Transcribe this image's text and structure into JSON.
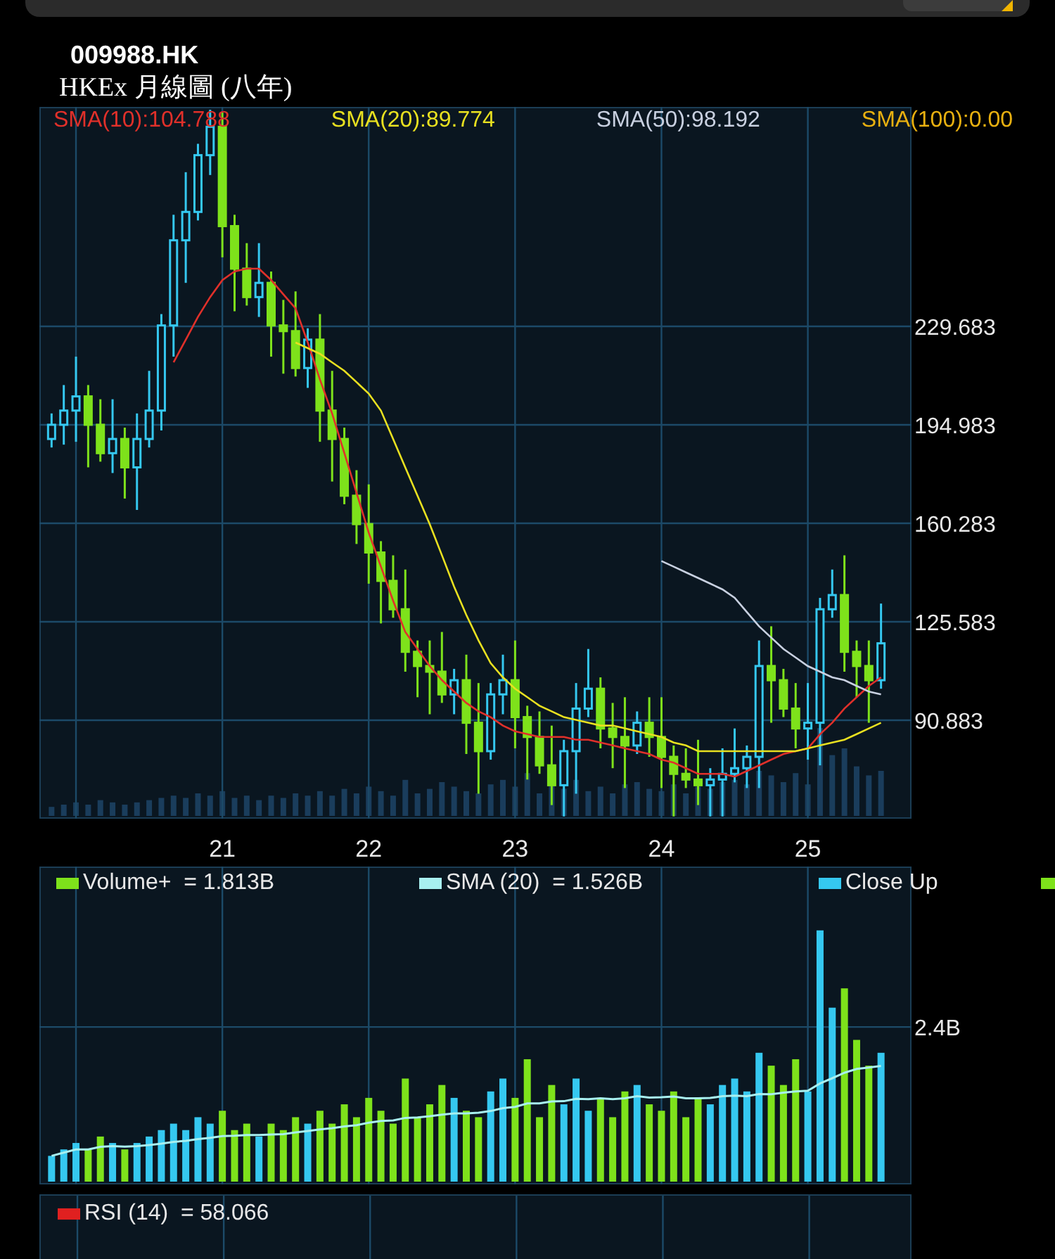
{
  "header": {
    "symbol": "009988.HK",
    "subtitle": "HKEx 月線圖 (八年)"
  },
  "price_chart": {
    "legend_extra": [
      {
        "label": "SMA(100):0.00",
        "color": "#e8b010"
      }
    ],
    "chart_data": {
      "type": "candlestick",
      "grid": true,
      "categories": [
        null,
        null,
        null,
        null,
        null,
        null,
        null,
        null,
        null,
        null,
        null,
        null,
        null,
        null,
        "21",
        null,
        null,
        null,
        null,
        null,
        null,
        null,
        null,
        null,
        null,
        null,
        "22",
        null,
        null,
        null,
        null,
        null,
        null,
        null,
        null,
        null,
        null,
        null,
        "23",
        null,
        null,
        null,
        null,
        null,
        null,
        null,
        null,
        null,
        null,
        null,
        "24",
        null,
        null,
        null,
        null,
        null,
        null,
        null,
        null,
        null,
        null,
        null,
        "25",
        null,
        null,
        null,
        null,
        null,
        null
      ],
      "yticks": [
        {
          "value": 90.883,
          "label": "90.883"
        },
        {
          "value": 125.583,
          "label": "125.583"
        },
        {
          "value": 160.283,
          "label": "160.283"
        },
        {
          "value": 194.983,
          "label": "194.983"
        },
        {
          "value": 229.683,
          "label": "229.683"
        }
      ],
      "ylim": [
        56.2,
        307
      ],
      "ohlc": [
        [
          190,
          199,
          187,
          195
        ],
        [
          195,
          209,
          188,
          200
        ],
        [
          200,
          219,
          189,
          205
        ],
        [
          205,
          209,
          180,
          195
        ],
        [
          195,
          204,
          182,
          185
        ],
        [
          185,
          204,
          178,
          190
        ],
        [
          190,
          194,
          169,
          180
        ],
        [
          180,
          199,
          165,
          190
        ],
        [
          190,
          214,
          187,
          200
        ],
        [
          200,
          234,
          193,
          230
        ],
        [
          230,
          269,
          219,
          260
        ],
        [
          260,
          284,
          245,
          270
        ],
        [
          270,
          294,
          267,
          290
        ],
        [
          290,
          306,
          283,
          300
        ],
        [
          300,
          305,
          254,
          265
        ],
        [
          265,
          269,
          235,
          250
        ],
        [
          250,
          259,
          237,
          240
        ],
        [
          240,
          259,
          233,
          245
        ],
        [
          245,
          249,
          219,
          230
        ],
        [
          230,
          239,
          213,
          228
        ],
        [
          228,
          242,
          212,
          215
        ],
        [
          215,
          229,
          208,
          225
        ],
        [
          225,
          234,
          189,
          200
        ],
        [
          200,
          214,
          175,
          190
        ],
        [
          190,
          194,
          167,
          170
        ],
        [
          170,
          179,
          153,
          160
        ],
        [
          160,
          174,
          139,
          150
        ],
        [
          150,
          154,
          125,
          140
        ],
        [
          140,
          149,
          127,
          130
        ],
        [
          130,
          144,
          108,
          115
        ],
        [
          115,
          119,
          99,
          110
        ],
        [
          110,
          119,
          93,
          108
        ],
        [
          108,
          122,
          97,
          100
        ],
        [
          100,
          109,
          93,
          105
        ],
        [
          105,
          114,
          79,
          90
        ],
        [
          90,
          104,
          65,
          80
        ],
        [
          80,
          104,
          77,
          100
        ],
        [
          100,
          114,
          93,
          105
        ],
        [
          105,
          119,
          81,
          92
        ],
        [
          92,
          96,
          70,
          85
        ],
        [
          85,
          94,
          72,
          75
        ],
        [
          75,
          89,
          61,
          68
        ],
        [
          68,
          84,
          57,
          80
        ],
        [
          80,
          104,
          65,
          95
        ],
        [
          95,
          116,
          92,
          102
        ],
        [
          102,
          106,
          81,
          88
        ],
        [
          88,
          97,
          74,
          85
        ],
        [
          85,
          99,
          67,
          82
        ],
        [
          82,
          94,
          79,
          90
        ],
        [
          90,
          99,
          78,
          85
        ],
        [
          85,
          99,
          67,
          78
        ],
        [
          78,
          82,
          57,
          72
        ],
        [
          72,
          81,
          67,
          70
        ],
        [
          70,
          84,
          61,
          68
        ],
        [
          68,
          74,
          57,
          70
        ],
        [
          70,
          81,
          57,
          72
        ],
        [
          72,
          88,
          69,
          74
        ],
        [
          74,
          82,
          67,
          78
        ],
        [
          78,
          119,
          67,
          110
        ],
        [
          110,
          124,
          90,
          105
        ],
        [
          105,
          109,
          92,
          95
        ],
        [
          95,
          104,
          81,
          88
        ],
        [
          88,
          104,
          77,
          90
        ],
        [
          90,
          134,
          75,
          130
        ],
        [
          130,
          144,
          127,
          135
        ],
        [
          135,
          149,
          108,
          115
        ],
        [
          115,
          119,
          99,
          110
        ],
        [
          110,
          119,
          90,
          105
        ],
        [
          105,
          132,
          102,
          118
        ]
      ],
      "series": [
        {
          "name": "SMA(10):104.788",
          "type": "line",
          "color": "#e0302a",
          "values": [
            null,
            null,
            null,
            null,
            null,
            null,
            null,
            null,
            null,
            null,
            217,
            225,
            233,
            240,
            246,
            249,
            250,
            250,
            246,
            241,
            236,
            224,
            211,
            199,
            185,
            171,
            157,
            145,
            133,
            122,
            116,
            110,
            105,
            101,
            97,
            94,
            92,
            89,
            87,
            86,
            85,
            85,
            85,
            84,
            84,
            83,
            82,
            81,
            80,
            79,
            77,
            76,
            74,
            72,
            72,
            72,
            71,
            73,
            75,
            77,
            79,
            80,
            81,
            86,
            90,
            95,
            99,
            103,
            106
          ]
        },
        {
          "name": "SMA(20):89.774",
          "type": "line",
          "color": "#e8e020",
          "values": [
            null,
            null,
            null,
            null,
            null,
            null,
            null,
            null,
            null,
            null,
            null,
            null,
            null,
            null,
            null,
            null,
            null,
            null,
            null,
            null,
            224,
            222,
            220,
            217,
            214,
            210,
            206,
            200,
            190,
            180,
            170,
            160,
            149,
            138,
            128,
            119,
            111,
            106,
            102,
            99,
            96,
            94,
            92,
            91,
            90,
            89,
            89,
            88,
            87,
            86,
            85,
            83,
            82,
            80,
            80,
            80,
            80,
            80,
            80,
            80,
            80,
            80,
            81,
            82,
            83,
            84,
            86,
            88,
            90
          ]
        },
        {
          "name": "SMA(50):98.192",
          "type": "line",
          "color": "#c8d0e0",
          "values": [
            null,
            null,
            null,
            null,
            null,
            null,
            null,
            null,
            null,
            null,
            null,
            null,
            null,
            null,
            null,
            null,
            null,
            null,
            null,
            null,
            null,
            null,
            null,
            null,
            null,
            null,
            null,
            null,
            null,
            null,
            null,
            null,
            null,
            null,
            null,
            null,
            null,
            null,
            null,
            null,
            null,
            null,
            null,
            null,
            null,
            null,
            null,
            null,
            null,
            null,
            147,
            145,
            143,
            141,
            139,
            137,
            134,
            129,
            124,
            120,
            116,
            113,
            110,
            108,
            106,
            105,
            103,
            101,
            100
          ]
        }
      ]
    }
  },
  "volume_chart": {
    "legend": [
      {
        "label": "Volume+  = 1.813B",
        "color": "#7ee21b"
      },
      {
        "label": "SMA (20)  = 1.526B",
        "color": "#a8f0f0"
      },
      {
        "label": "Close Up",
        "color": "#35c8f0"
      },
      {
        "color": "#7ee21b"
      }
    ],
    "axis_label": "2.4B"
  },
  "rsi_chart": {
    "legend": [
      {
        "label": "RSI (14)  = 58.066",
        "color": "#e02020"
      }
    ]
  }
}
